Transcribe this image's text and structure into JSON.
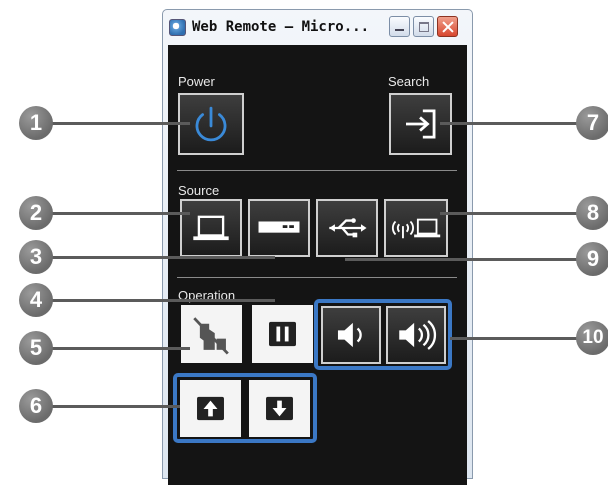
{
  "window": {
    "title": "Web Remote – Micro...",
    "controls": [
      "minimize",
      "maximize",
      "close"
    ]
  },
  "sections": {
    "power": "Power",
    "search": "Search",
    "source": "Source",
    "operation": "Operation"
  },
  "buttons": {
    "power": {
      "icon": "power-icon"
    },
    "search": {
      "icon": "source-search-icon"
    },
    "computer": {
      "icon": "computer-icon"
    },
    "video": {
      "icon": "video-device-icon"
    },
    "usb": {
      "icon": "usb-icon"
    },
    "network": {
      "icon": "network-computer-icon"
    },
    "av_mute": {
      "icon": "av-mute-icon"
    },
    "freeze": {
      "icon": "freeze-icon"
    },
    "volume_down": {
      "icon": "volume-down-icon"
    },
    "volume_up": {
      "icon": "volume-up-icon"
    },
    "page_up": {
      "icon": "arrow-up-icon"
    },
    "page_down": {
      "icon": "arrow-down-icon"
    }
  },
  "callouts": [
    "1",
    "2",
    "3",
    "4",
    "5",
    "6",
    "7",
    "8",
    "9",
    "10"
  ],
  "colors": {
    "panel": "#141414",
    "group_highlight": "#3b78c5",
    "power_icon": "#3a8ad8"
  }
}
